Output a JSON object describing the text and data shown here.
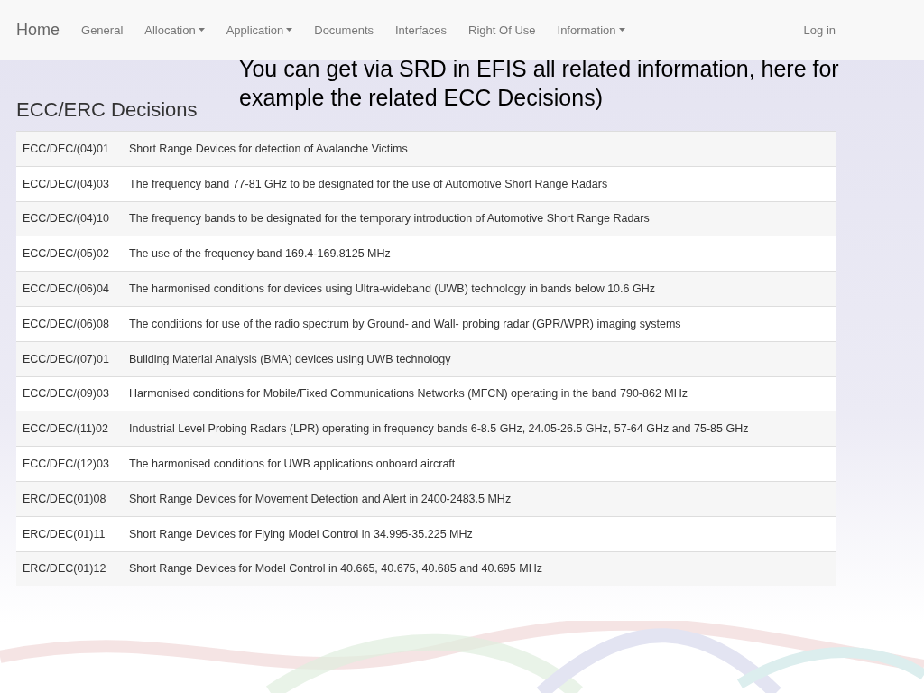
{
  "navbar": {
    "brand": "Home",
    "items": [
      {
        "label": "General",
        "dropdown": false
      },
      {
        "label": "Allocation",
        "dropdown": true
      },
      {
        "label": "Application",
        "dropdown": true
      },
      {
        "label": "Documents",
        "dropdown": false
      },
      {
        "label": "Interfaces",
        "dropdown": false
      },
      {
        "label": "Right Of Use",
        "dropdown": false
      },
      {
        "label": "Information",
        "dropdown": true
      }
    ],
    "login": "Log in"
  },
  "annotation": "You can get via SRD in EFIS all related information, here for example the related ECC Decisions)",
  "heading": "ECC/ERC Decisions",
  "table": {
    "rows": [
      {
        "code": "ECC/DEC/(04)01",
        "title": "Short Range Devices for detection of Avalanche Victims"
      },
      {
        "code": "ECC/DEC/(04)03",
        "title": "The frequency band 77-81 GHz to be designated for the use of Automotive Short Range Radars"
      },
      {
        "code": "ECC/DEC/(04)10",
        "title": "The frequency bands to be designated for the temporary introduction of Automotive Short Range Radars"
      },
      {
        "code": "ECC/DEC/(05)02",
        "title": "The use of the frequency band 169.4-169.8125 MHz"
      },
      {
        "code": "ECC/DEC/(06)04",
        "title": "The harmonised conditions for devices using Ultra-wideband (UWB) technology in bands below 10.6 GHz"
      },
      {
        "code": "ECC/DEC/(06)08",
        "title": "The conditions for use of the radio spectrum by Ground- and Wall- probing radar (GPR/WPR) imaging systems"
      },
      {
        "code": "ECC/DEC/(07)01",
        "title": "Building Material Analysis (BMA) devices using UWB technology"
      },
      {
        "code": "ECC/DEC/(09)03",
        "title": "Harmonised conditions for Mobile/Fixed Communications Networks (MFCN) operating in the band 790-862 MHz"
      },
      {
        "code": "ECC/DEC/(11)02",
        "title": "Industrial Level Probing Radars (LPR) operating in frequency bands 6-8.5 GHz, 24.05-26.5 GHz, 57-64 GHz and 75-85 GHz"
      },
      {
        "code": "ECC/DEC/(12)03",
        "title": "The harmonised conditions for UWB applications onboard aircraft"
      },
      {
        "code": "ERC/DEC(01)08",
        "title": "Short Range Devices for Movement Detection and Alert in 2400-2483.5 MHz"
      },
      {
        "code": "ERC/DEC(01)11",
        "title": "Short Range Devices for Flying Model Control in 34.995-35.225 MHz"
      },
      {
        "code": "ERC/DEC(01)12",
        "title": "Short Range Devices for Model Control in 40.665, 40.675, 40.685 and 40.695 MHz"
      }
    ]
  }
}
